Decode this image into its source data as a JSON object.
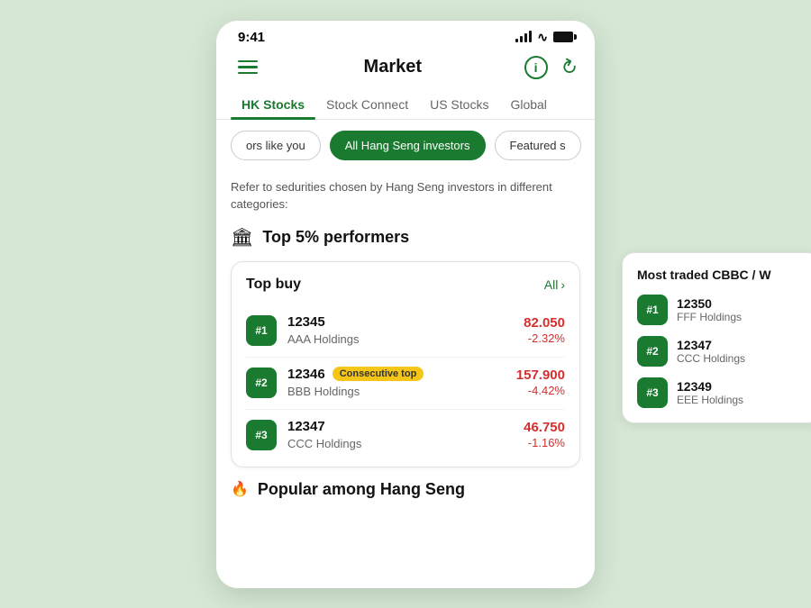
{
  "statusBar": {
    "time": "9:41"
  },
  "header": {
    "title": "Market",
    "menuLabel": "menu",
    "infoLabel": "info",
    "refreshLabel": "refresh"
  },
  "tabs": [
    {
      "label": "HK Stocks",
      "active": true
    },
    {
      "label": "Stock Connect",
      "active": false
    },
    {
      "label": "US Stocks",
      "active": false
    },
    {
      "label": "Global",
      "active": false
    }
  ],
  "filters": [
    {
      "label": "ors like you",
      "active": false
    },
    {
      "label": "All Hang Seng investors",
      "active": true
    },
    {
      "label": "Featured s",
      "active": false
    }
  ],
  "subtitleText": "Refer to sedurities chosen by Hang Seng investors in different categories:",
  "topSection": {
    "icon": "🏛",
    "title": "Top 5% performers"
  },
  "topBuyCard": {
    "title": "Top buy",
    "allLabel": "All",
    "stocks": [
      {
        "rank": "#1",
        "code": "12345",
        "company": "AAA Holdings",
        "price": "82.050",
        "change": "-2.32%",
        "badge": null
      },
      {
        "rank": "#2",
        "code": "12346",
        "company": "BBB Holdings",
        "price": "157.900",
        "change": "-4.42%",
        "badge": "Consecutive top"
      },
      {
        "rank": "#3",
        "code": "12347",
        "company": "CCC Holdings",
        "price": "46.750",
        "change": "-1.16%",
        "badge": null
      }
    ]
  },
  "popularSection": {
    "icon": "🔥",
    "title": "Popular among Hang Seng"
  },
  "sidePanel": {
    "title": "Most traded CBBC / W",
    "stocks": [
      {
        "rank": "#1",
        "code": "12350",
        "company": "FFF Holdings"
      },
      {
        "rank": "#2",
        "code": "12347",
        "company": "CCC Holdings"
      },
      {
        "rank": "#3",
        "code": "12349",
        "company": "EEE Holdings"
      }
    ]
  },
  "colors": {
    "green": "#1a7a30",
    "red": "#d32f2f",
    "yellow": "#f5c518",
    "lightBg": "#d6e8d5"
  }
}
